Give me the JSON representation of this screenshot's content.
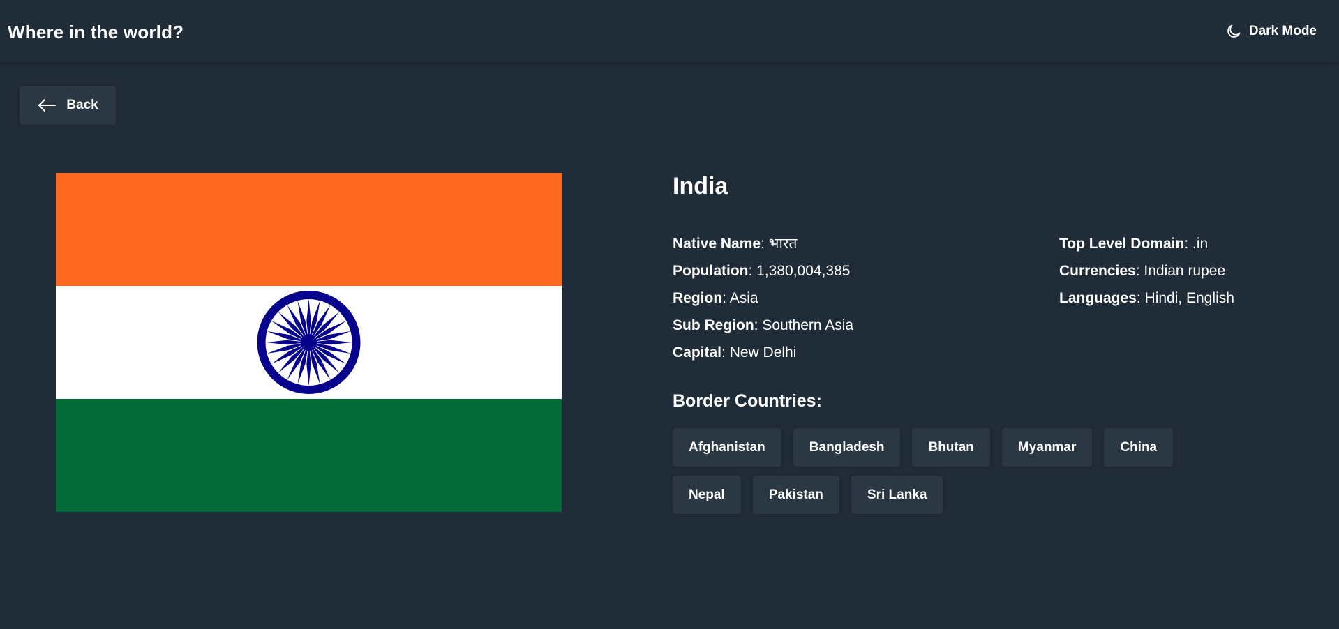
{
  "header": {
    "title": "Where in the world?",
    "mode_label": "Dark Mode",
    "mode_icon": "moon-icon"
  },
  "back_button": {
    "label": "Back",
    "icon": "arrow-left-icon"
  },
  "flag": {
    "colors": {
      "saffron": "#ff6820",
      "white": "#ffffff",
      "green": "#046a38",
      "chakra": "#07038d"
    }
  },
  "country": {
    "name": "India",
    "native_name_label": "Native Name",
    "native_name": "भारत",
    "population_label": "Population",
    "population": "1,380,004,385",
    "region_label": "Region",
    "region": "Asia",
    "sub_region_label": "Sub Region",
    "sub_region": "Southern Asia",
    "capital_label": "Capital",
    "capital": "New Delhi",
    "tld_label": "Top Level Domain",
    "tld": ".in",
    "currencies_label": "Currencies",
    "currencies": "Indian rupee",
    "languages_label": "Languages",
    "languages": "Hindi, English"
  },
  "borders": {
    "title": "Border Countries:",
    "countries": [
      "Afghanistan",
      "Bangladesh",
      "Bhutan",
      "Myanmar",
      "China",
      "Nepal",
      "Pakistan",
      "Sri Lanka"
    ]
  },
  "theme": {
    "background": "#202c37",
    "element": "#2b3844",
    "text": "#ffffff"
  }
}
